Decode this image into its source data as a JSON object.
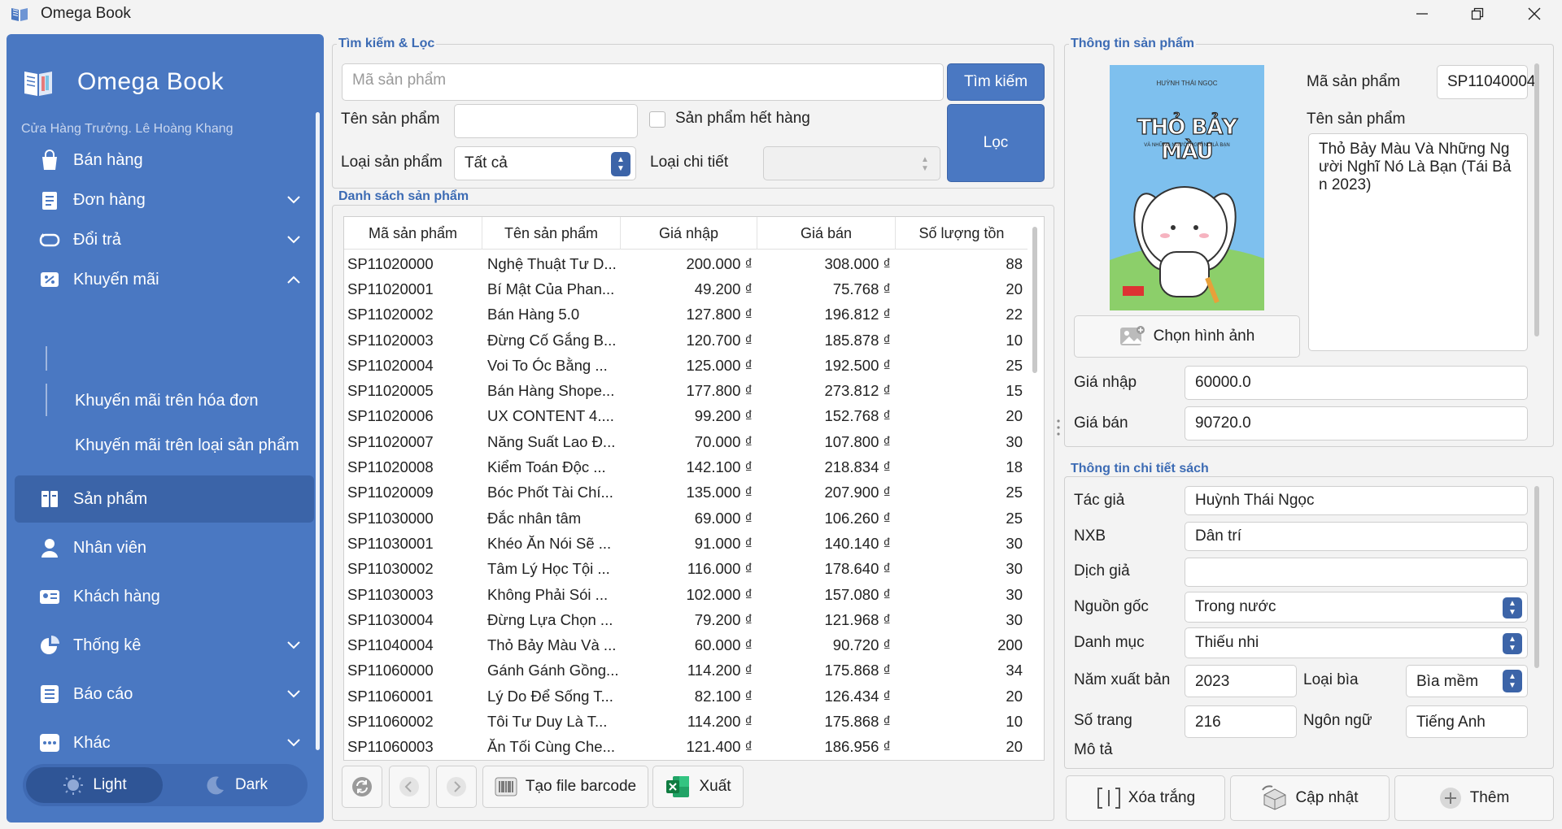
{
  "window": {
    "title": "Omega Book"
  },
  "sidebar": {
    "brand": "Omega Book",
    "user": "Cửa Hàng Trưởng. Lê Hoàng Khang",
    "items": [
      {
        "label": "Bán hàng",
        "icon": "shopping-bag-icon",
        "chevron": ""
      },
      {
        "label": "Đơn hàng",
        "icon": "order-list-icon",
        "chevron": "down"
      },
      {
        "label": "Đổi trả",
        "icon": "return-icon",
        "chevron": "down"
      },
      {
        "label": "Khuyến mãi",
        "icon": "discount-icon",
        "chevron": "up"
      },
      {
        "label": "Sản phẩm",
        "icon": "product-icon",
        "chevron": ""
      },
      {
        "label": "Nhân viên",
        "icon": "user-icon",
        "chevron": ""
      },
      {
        "label": "Khách hàng",
        "icon": "customer-card-icon",
        "chevron": ""
      },
      {
        "label": "Thống kê",
        "icon": "pie-chart-icon",
        "chevron": "down"
      },
      {
        "label": "Báo cáo",
        "icon": "report-icon",
        "chevron": "down"
      },
      {
        "label": "Khác",
        "icon": "more-icon",
        "chevron": "down"
      }
    ],
    "subitems": [
      "Khuyến mãi trên hóa đơn",
      "Khuyến mãi trên loại sản phẩm"
    ],
    "theme": {
      "light": "Light",
      "dark": "Dark",
      "selected": "Light"
    }
  },
  "search": {
    "title": "Tìm kiếm & Lọc",
    "code_placeholder": "Mã sản phẩm",
    "search_button": "Tìm kiếm",
    "name_label": "Tên sản phẩm",
    "name_value": "",
    "out_of_stock_label": "Sản phẩm hết hàng",
    "out_of_stock_checked": false,
    "type_label": "Loại sản phẩm",
    "type_value": "Tất cả",
    "detail_type_label": "Loại chi tiết",
    "detail_type_value": "",
    "filter_button": "Lọc"
  },
  "product_list": {
    "title": "Danh sách sản phẩm",
    "columns": [
      "Mã sản phẩm",
      "Tên sản phẩm",
      "Giá nhập",
      "Giá bán",
      "Số lượng tồn"
    ],
    "rows": [
      [
        "SP11020000",
        "Nghệ Thuật Tư D...",
        "200.000 ₫",
        "308.000 ₫",
        "88"
      ],
      [
        "SP11020001",
        "Bí Mật Của Phan...",
        "49.200 ₫",
        "75.768 ₫",
        "20"
      ],
      [
        "SP11020002",
        "Bán Hàng 5.0",
        "127.800 ₫",
        "196.812 ₫",
        "22"
      ],
      [
        "SP11020003",
        "Đừng Cố Gắng B...",
        "120.700 ₫",
        "185.878 ₫",
        "10"
      ],
      [
        "SP11020004",
        "Voi To Óc Bằng ...",
        "125.000 ₫",
        "192.500 ₫",
        "25"
      ],
      [
        "SP11020005",
        "Bán Hàng Shope...",
        "177.800 ₫",
        "273.812 ₫",
        "15"
      ],
      [
        "SP11020006",
        "UX CONTENT 4....",
        "99.200 ₫",
        "152.768 ₫",
        "20"
      ],
      [
        "SP11020007",
        "Năng Suất Lao Đ...",
        "70.000 ₫",
        "107.800 ₫",
        "30"
      ],
      [
        "SP11020008",
        "Kiểm Toán Độc ...",
        "142.100 ₫",
        "218.834 ₫",
        "18"
      ],
      [
        "SP11020009",
        "Bóc Phốt Tài Chí...",
        "135.000 ₫",
        "207.900 ₫",
        "25"
      ],
      [
        "SP11030000",
        "Đắc nhân tâm",
        "69.000 ₫",
        "106.260 ₫",
        "25"
      ],
      [
        "SP11030001",
        "Khéo Ăn Nói Sẽ ...",
        "91.000 ₫",
        "140.140 ₫",
        "30"
      ],
      [
        "SP11030002",
        "Tâm Lý Học Tội ...",
        "116.000 ₫",
        "178.640 ₫",
        "30"
      ],
      [
        "SP11030003",
        "Không Phải Sói ...",
        "102.000 ₫",
        "157.080 ₫",
        "30"
      ],
      [
        "SP11030004",
        "Đừng Lựa Chọn ...",
        "79.200 ₫",
        "121.968 ₫",
        "30"
      ],
      [
        "SP11040004",
        "Thỏ Bảy Màu Và ...",
        "60.000 ₫",
        "90.720 ₫",
        "200"
      ],
      [
        "SP11060000",
        "Gánh Gánh Gồng...",
        "114.200 ₫",
        "175.868 ₫",
        "34"
      ],
      [
        "SP11060001",
        "Lý Do Để Sống T...",
        "82.100 ₫",
        "126.434 ₫",
        "20"
      ],
      [
        "SP11060002",
        "Tôi Tư Duy Là T...",
        "114.200 ₫",
        "175.868 ₫",
        "10"
      ],
      [
        "SP11060003",
        "Ăn Tối Cùng Che...",
        "121.400 ₫",
        "186.956 ₫",
        "20"
      ]
    ],
    "barcode_button": "Tạo file barcode",
    "export_button": "Xuất"
  },
  "product_info": {
    "title": "Thông tin sản phẩm",
    "code_label": "Mã sản phẩm",
    "code_value": "SP11040004",
    "name_label": "Tên sản phẩm",
    "name_value": "Thỏ Bảy Màu Và Những Người Nghĩ Nó Là Bạn (Tái Bản 2023)",
    "choose_image_button": "Chọn hình ảnh",
    "cover": {
      "author": "HUỲNH THÁI NGỌC",
      "title": "THỎ BẢY MÀU",
      "subtitle": "VÀ NHỮNG NGƯỜI NGHĨ NÓ LÀ BẠN"
    },
    "import_price_label": "Giá nhập",
    "import_price_value": "60000.0",
    "sale_price_label": "Giá bán",
    "sale_price_value": "90720.0"
  },
  "book_detail": {
    "title": "Thông tin chi tiết sách",
    "author_label": "Tác giả",
    "author_value": "Huỳnh Thái Ngọc",
    "publisher_label": "NXB",
    "publisher_value": "Dân trí",
    "translator_label": "Dịch giả",
    "translator_value": "",
    "origin_label": "Nguồn gốc",
    "origin_value": "Trong nước",
    "category_label": "Danh mục",
    "category_value": "Thiếu nhi",
    "year_label": "Năm xuất bản",
    "year_value": "2023",
    "cover_type_label": "Loại bìa",
    "cover_type_value": "Bìa mềm",
    "pages_label": "Số trang",
    "pages_value": "216",
    "language_label": "Ngôn ngữ",
    "language_value": "Tiếng Anh",
    "description_label": "Mô tả"
  },
  "actions": {
    "clear": "Xóa trắng",
    "update": "Cập nhật",
    "add": "Thêm"
  },
  "colors": {
    "sidebar": "#4a78c2",
    "accent_text": "#3c6bb4",
    "button": "#4a78c2"
  }
}
